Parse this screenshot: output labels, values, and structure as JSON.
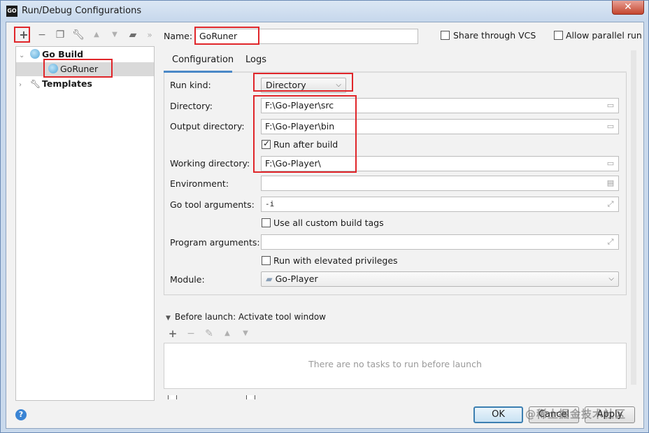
{
  "window": {
    "title": "Run/Debug Configurations",
    "app_icon_text": "GO",
    "close_glyph": "✕"
  },
  "toolbar": {
    "icons": [
      "plus-icon",
      "minus-icon",
      "copy-icon",
      "wrench-icon",
      "arrow-up-icon",
      "arrow-down-icon",
      "folder-add-icon",
      "more-icon"
    ]
  },
  "tree": {
    "items": [
      {
        "label": "Go Build",
        "bold": true,
        "expanded": true
      },
      {
        "label": "GoRuner",
        "selected": true
      },
      {
        "label": "Templates",
        "bold": true,
        "expanded": false
      }
    ]
  },
  "header": {
    "name_label": "Name:",
    "name_value": "GoRuner",
    "share_vcs_label": "Share through VCS",
    "share_vcs_checked": false,
    "allow_parallel_label": "Allow parallel run",
    "allow_parallel_checked": false
  },
  "tabs": [
    {
      "label": "Configuration",
      "active": true
    },
    {
      "label": "Logs",
      "active": false
    }
  ],
  "form": {
    "run_kind_label": "Run kind:",
    "run_kind_value": "Directory",
    "directory_label": "Directory:",
    "directory_value": "F:\\Go-Player\\src",
    "output_directory_label": "Output directory:",
    "output_directory_value": "F:\\Go-Player\\bin",
    "run_after_build_label": "Run after build",
    "run_after_build_checked": true,
    "working_directory_label": "Working directory:",
    "working_directory_value": "F:\\Go-Player\\",
    "environment_label": "Environment:",
    "environment_value": "",
    "go_tool_arguments_label": "Go tool arguments:",
    "go_tool_arguments_value": "-i",
    "custom_build_tags_label": "Use all custom build tags",
    "custom_build_tags_checked": false,
    "program_arguments_label": "Program arguments:",
    "program_arguments_value": "",
    "elevated_privileges_label": "Run with elevated privileges",
    "elevated_privileges_checked": false,
    "module_label": "Module:",
    "module_value": "Go-Player"
  },
  "before_launch": {
    "title": "Before launch: Activate tool window",
    "empty_text": "There are no tasks to run before launch"
  },
  "buttons": {
    "ok": "OK",
    "cancel": "Cancel",
    "apply": "Apply"
  },
  "help_glyph": "?",
  "watermark": "@稀土掘金技术社区",
  "colors": {
    "highlight_red": "#e0262a",
    "tab_accent": "#4a88c7",
    "selection_bg": "#d9d9d9"
  }
}
